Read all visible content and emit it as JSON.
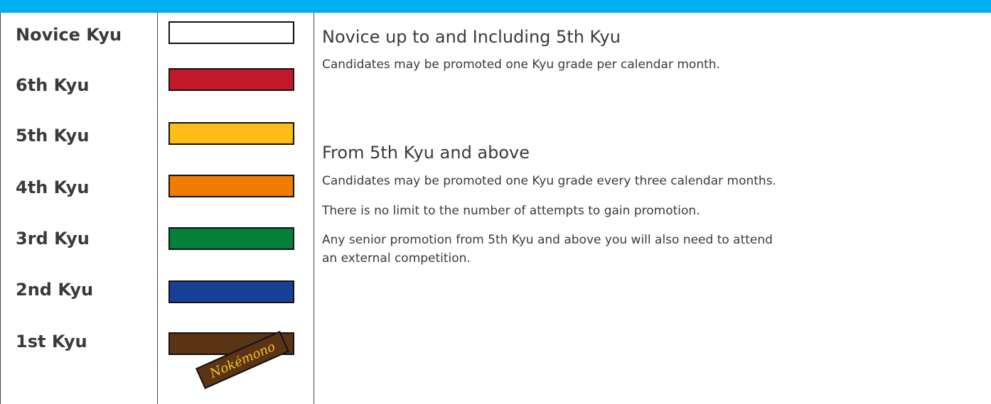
{
  "grades": [
    {
      "label": "Novice Kyu",
      "belt_color": "#ffffff"
    },
    {
      "label": "6th Kyu",
      "belt_color": "#c4192a"
    },
    {
      "label": "5th Kyu",
      "belt_color": "#fcbd14"
    },
    {
      "label": "4th Kyu",
      "belt_color": "#f07c00"
    },
    {
      "label": "3rd Kyu",
      "belt_color": "#04803b"
    },
    {
      "label": "2nd Kyu",
      "belt_color": "#183f98"
    },
    {
      "label": "1st Kyu",
      "belt_color": "#5b3416"
    }
  ],
  "belt_tag": {
    "text": "Nokémono",
    "color": "#5b3416",
    "text_color": "#f7c41a"
  },
  "sections": [
    {
      "heading": "Novice up to and Including 5th Kyu",
      "lines": [
        "Candidates may be promoted one Kyu grade per calendar month."
      ]
    },
    {
      "heading": "From 5th Kyu and above",
      "lines": [
        "Candidates may be promoted one Kyu grade every three calendar months.",
        "There is no limit to the number of attempts to gain promotion.",
        "Any senior promotion from 5th Kyu and above you will also need to attend",
        "an external competition."
      ]
    }
  ],
  "colors": {
    "header_bar": "#00aeef",
    "divider": "#444444"
  }
}
